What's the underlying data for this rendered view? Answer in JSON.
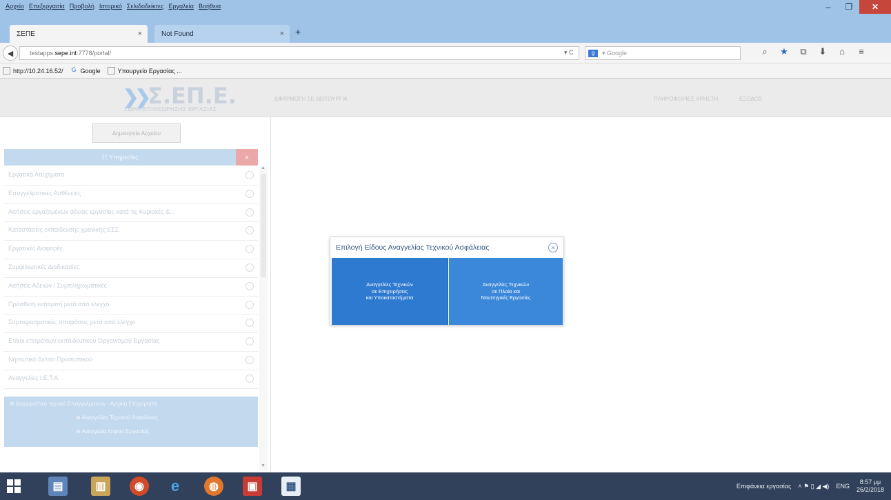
{
  "browser": {
    "menu": [
      "Αρχείο",
      "Επεξεργασία",
      "Προβολή",
      "Ιστορικό",
      "Σελιδοδείκτες",
      "Εργαλεία",
      "Βοήθεια"
    ],
    "window_controls": {
      "minimize": "–",
      "maximize": "❐",
      "close": "✕"
    },
    "tabs": [
      {
        "title": "ΣΕΠΕ",
        "close": "×"
      },
      {
        "title": "Not Found",
        "close": "×"
      }
    ],
    "new_tab": "+",
    "url": {
      "prefix": "testapps.",
      "host": "sepe.int",
      "suffix": ":7778/portal/"
    },
    "url_controls": "▾ C",
    "search": {
      "engine_icon": "g",
      "placeholder": "▾ Google"
    },
    "nav_icons": {
      "search": "⌕",
      "bookmark_star": "★",
      "clipboard": "⧉",
      "download": "⬇",
      "home": "⌂",
      "menu": "≡"
    },
    "bookmarks": [
      {
        "label": "http://10.24.16.52/",
        "icon": ""
      },
      {
        "label": "Google",
        "icon": "G"
      },
      {
        "label": "Υπουργείο Εργασίας ...",
        "icon": ""
      }
    ]
  },
  "header": {
    "logo_mark": "Σ.ΕΠ.Ε.",
    "logo_subtitle": "ΣΩΜΑ ΕΠΙΘΕΩΡΗΣΗΣ ΕΡΓΑΣΙΑΣ",
    "app_title": "ΕΦΑΡΜΟΓΗ ΣΕ ΛΕΙΤΟΥΡΓΙΑ",
    "user_link": "ΠΛΗΡΟΦΟΡΙΕΣ ΧΡΗΣΤΗ",
    "logout_link": "ΕΞΟΔΟΣ"
  },
  "sidebar": {
    "top_button": "Δημιουργία Αρχείου",
    "section_title": "☷ Υπηρεσίες",
    "close_label": "✕",
    "items": [
      "Εργατικά Ατυχήματα",
      "Επαγγελματικές Ασθένειες",
      "Αιτήσεις εργαζομένων άδειας εργασίας κατά τις Κυριακές &...",
      "Καταστάσεις εκπαίδευσης χρονικής ΕΣΣ",
      "Εργατικές Διαφορές",
      "Συμφιλιωτικές Διαδικασίες",
      "Αιτήσεις Αδειών / Συμπληρωματικές",
      "Πρόσθετη εκπομπή μετά από έλεγχο",
      "Συμπερασματικές αποφάσεις μετά από έλεγχο",
      "Ετ/κοι επιτρόπων εκπαιδευτικού Οργανισμού Εργασίας",
      "Νησιωτικό Δελτίο Προσωπικού",
      "Αναγγελίες Ι.Ε.Τ.Α"
    ],
    "subpanel": {
      "title": "⊕ Διαχειριστικό τεχνικό Επαγγελματιών - Αρχική Επιχείρηση",
      "links": [
        "⊕ Αναγγελίες Τεχνικού Ασφάλειας",
        "⊕ Αναγγελία Ιατρού Εργασίας"
      ]
    },
    "scroll_up": "▲",
    "scroll_down": "▼"
  },
  "dialog": {
    "title": "Επιλογή Είδους Αναγγελίας Τεχνικού Ασφάλειας",
    "close": "✕",
    "options": [
      [
        "Αναγγελίες Τεχνικών",
        "σε Επιχειρήσεις",
        "και Υποκαταστήματα"
      ],
      [
        "Αναγγελίες Τεχνικών",
        "σε Πλοία και",
        "Ναυπηγικές Εργασίες"
      ]
    ]
  },
  "taskbar": {
    "apps": [
      "▤",
      "▥",
      "◉",
      "e",
      "◍",
      "▣",
      "▦"
    ],
    "tray_text": "Επιφάνεια εργασίας",
    "tray_icons": "˄  ⚑  ▯  ◢  ◀)",
    "language": "ENG",
    "time": "8:57 μμ",
    "date": "26/2/2018"
  },
  "colors": {
    "chrome_blue": "#9fc3e7",
    "dialog_blue": "#2f7ad1",
    "sidebar_head": "#c2d9ee",
    "taskbar": "#31415b"
  }
}
